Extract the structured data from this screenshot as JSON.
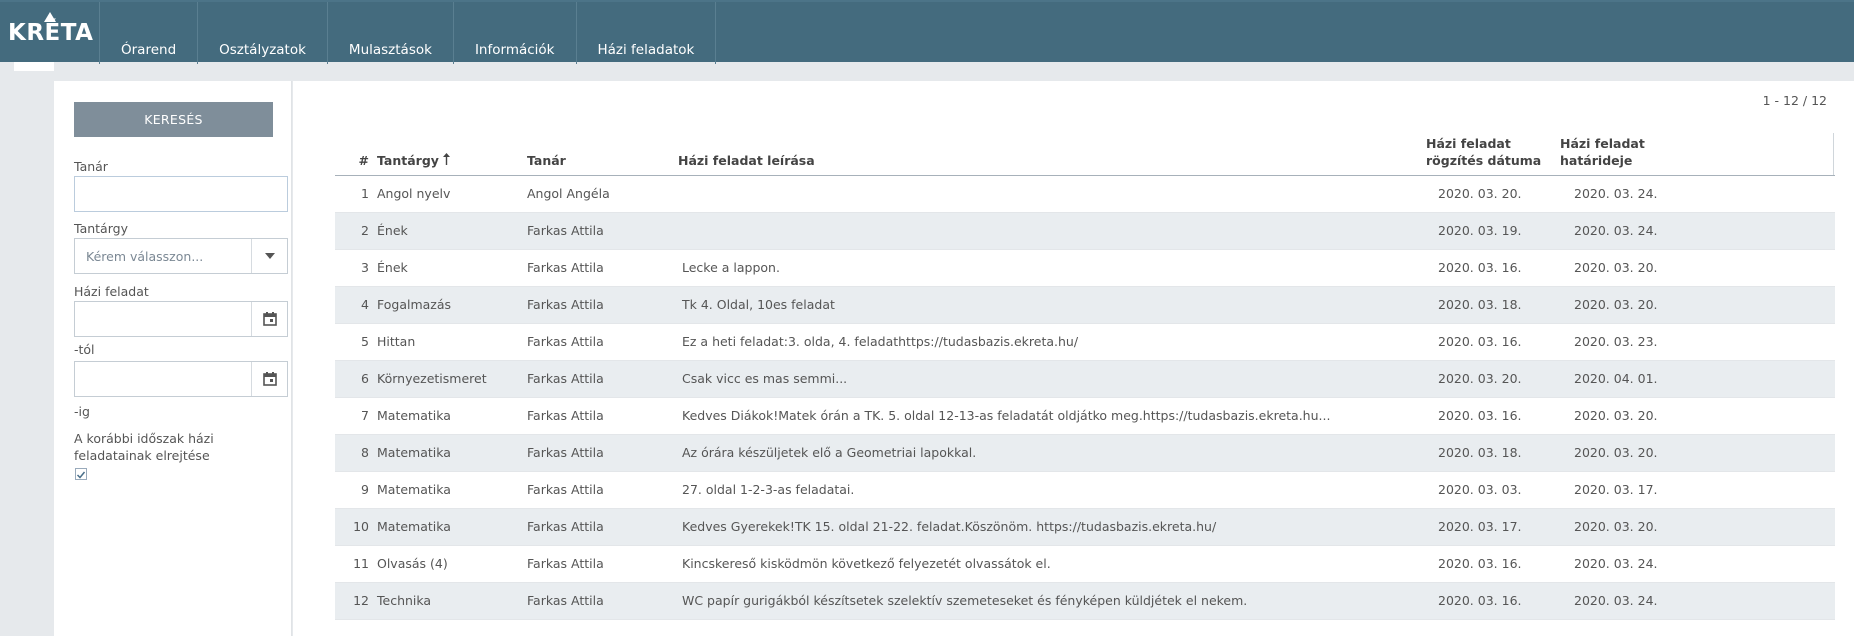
{
  "app": {
    "logo_text": "KRÉTA"
  },
  "nav": [
    {
      "label": "Órarend"
    },
    {
      "label": "Osztályzatok"
    },
    {
      "label": "Mulasztások"
    },
    {
      "label": "Információk"
    },
    {
      "label": "Házi feladatok"
    }
  ],
  "sidebar": {
    "search_button": "KERESÉS",
    "teacher_label": "Tanár",
    "teacher_value": "",
    "subject_label": "Tantárgy",
    "subject_placeholder": "Kérem válasszon...",
    "homework_label": "Házi feladat",
    "from_value": "",
    "from_label": "-tól",
    "to_value": "",
    "to_label": "-ig",
    "hide_label": "A korábbi időszak házi feladatainak elrejtése",
    "hide_checked": true,
    "icons": [
      "chevron-down-icon",
      "calendar-icon",
      "check-icon"
    ]
  },
  "pager": {
    "text": "1 - 12 / 12"
  },
  "table": {
    "headers": {
      "num": "#",
      "subject": "Tantárgy",
      "teacher": "Tanár",
      "description": "Házi feladat leírása",
      "recorded_line1": "Házi feladat",
      "recorded_line2": "rögzítés dátuma",
      "due_line1": "Házi feladat",
      "due_line2": "határideje"
    },
    "sort": {
      "column": "subject",
      "direction": "ascending",
      "icon": "sort-arrow-up-icon"
    },
    "rows": [
      {
        "num": "1",
        "subject": "Angol nyelv",
        "teacher": "Angol Angéla",
        "description": "",
        "recorded": "2020. 03. 20.",
        "due": "2020. 03. 24."
      },
      {
        "num": "2",
        "subject": "Ének",
        "teacher": "Farkas Attila",
        "description": "",
        "recorded": "2020. 03. 19.",
        "due": "2020. 03. 24."
      },
      {
        "num": "3",
        "subject": "Ének",
        "teacher": "Farkas Attila",
        "description": "Lecke a lappon.",
        "recorded": "2020. 03. 16.",
        "due": "2020. 03. 20."
      },
      {
        "num": "4",
        "subject": "Fogalmazás",
        "teacher": "Farkas Attila",
        "description": "Tk 4. Oldal, 10es feladat",
        "recorded": "2020. 03. 18.",
        "due": "2020. 03. 20."
      },
      {
        "num": "5",
        "subject": "Hittan",
        "teacher": "Farkas Attila",
        "description": " Ez a heti feladat:3. olda, 4. feladathttps://tudasbazis.ekreta.hu/",
        "recorded": "2020. 03. 16.",
        "due": "2020. 03. 23."
      },
      {
        "num": "6",
        "subject": "Környezetismeret",
        "teacher": "Farkas Attila",
        "description": "Csak vicc es mas semmi...",
        "recorded": "2020. 03. 20.",
        "due": "2020. 04. 01."
      },
      {
        "num": "7",
        "subject": "Matematika",
        "teacher": "Farkas Attila",
        "description": "Kedves Diákok!Matek órán a TK. 5. oldal 12-13-as feladatát oldjátko meg.https://tudasbazis.ekreta.hu...",
        "recorded": "2020. 03. 16.",
        "due": "2020. 03. 20."
      },
      {
        "num": "8",
        "subject": "Matematika",
        "teacher": "Farkas Attila",
        "description": "Az órára készüljetek elő a Geometriai lapokkal.",
        "recorded": "2020. 03. 18.",
        "due": "2020. 03. 20."
      },
      {
        "num": "9",
        "subject": "Matematika",
        "teacher": "Farkas Attila",
        "description": "27. oldal 1-2-3-as feladatai.",
        "recorded": "2020. 03. 03.",
        "due": "2020. 03. 17."
      },
      {
        "num": "10",
        "subject": "Matematika",
        "teacher": "Farkas Attila",
        "description": "Kedves Gyerekek!TK 15. oldal 21-22. feladat.Köszönöm. https://tudasbazis.ekreta.hu/",
        "recorded": "2020. 03. 17.",
        "due": "2020. 03. 20."
      },
      {
        "num": "11",
        "subject": "Olvasás (4)",
        "teacher": "Farkas Attila",
        "description": "Kincskereső kisködmön következő felyezetét olvassátok el.",
        "recorded": "2020. 03. 16.",
        "due": "2020. 03. 24."
      },
      {
        "num": "12",
        "subject": "Technika",
        "teacher": "Farkas Attila",
        "description": "WC papír gurigákból készítsetek szelektív szemeteseket és fényképen küldjétek el nekem.",
        "recorded": "2020. 03. 16.",
        "due": "2020. 03. 24."
      }
    ]
  },
  "colors": {
    "topbar": "#446b7e",
    "button": "#7f8e9a",
    "row_alt": "#e9edf0",
    "background": "#e6e9ec"
  }
}
